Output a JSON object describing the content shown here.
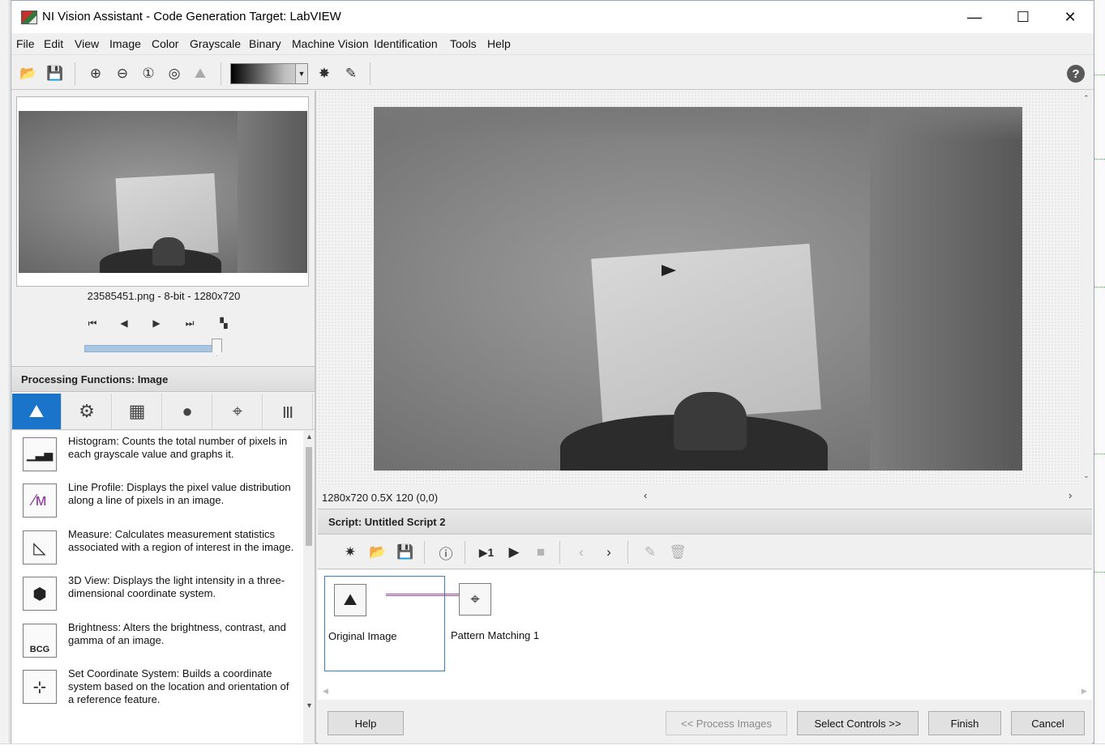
{
  "window": {
    "title": "NI Vision Assistant - Code Generation Target: LabVIEW",
    "minimize_glyph": "—",
    "maximize_glyph": "☐",
    "close_glyph": "✕"
  },
  "menu": [
    "File",
    "Edit",
    "View",
    "Image",
    "Color",
    "Grayscale",
    "Binary",
    "Machine Vision",
    "Identification",
    "Tools",
    "Help"
  ],
  "toolbar": {
    "icons": [
      "open-folder-icon",
      "save-icon",
      "zoom-in-icon",
      "zoom-out-icon",
      "zoom-1to1-icon",
      "zoom-fit-icon",
      "zoom-region-icon",
      "palette-dropdown",
      "brightness-icon",
      "annotate-pen-icon",
      "help-icon"
    ],
    "help_glyph": "?"
  },
  "browser": {
    "file_info": "23585451.png - 8-bit - 1280x720",
    "nav_glyphs": [
      "⏮",
      "◀",
      "▶",
      "⏭",
      "▚"
    ]
  },
  "processing": {
    "header": "Processing Functions: Image",
    "tabs": [
      "image-functions",
      "color-functions",
      "grayscale-functions",
      "binary-functions",
      "machine-vision-functions",
      "identification-functions"
    ],
    "tab_glyphs": [
      "⛰",
      "⚙",
      "▦",
      "●",
      "⌖",
      "|||"
    ],
    "items": [
      {
        "text": "Histogram:  Counts the total number of pixels in each grayscale value and graphs it.",
        "glyph": "▁▃▅",
        "icon": "histogram-icon"
      },
      {
        "text": "Line Profile:  Displays the pixel value distribution along a line of pixels in an image.",
        "glyph": "∕ᴍ",
        "icon": "line-profile-icon"
      },
      {
        "text": "Measure:  Calculates measurement statistics associated with a region of interest in the image.",
        "glyph": "◺",
        "icon": "measure-icon"
      },
      {
        "text": "3D View:  Displays the light intensity in a three-dimensional coordinate system.",
        "glyph": "⬢",
        "icon": "3d-view-icon"
      },
      {
        "text": "Brightness:  Alters the brightness, contrast, and gamma of an image.",
        "glyph": "BCG",
        "icon": "brightness-icon"
      },
      {
        "text": "Set Coordinate System:  Builds a coordinate system based on the location and orientation of a reference feature.",
        "glyph": "⊹",
        "icon": "coordinate-system-icon"
      }
    ]
  },
  "image_view": {
    "status": "1280x720 0.5X 120    (0,0)"
  },
  "script": {
    "header": "Script: Untitled Script 2",
    "steps": [
      {
        "label": "Original Image",
        "glyph": "⛰",
        "icon": "original-image-icon"
      },
      {
        "label": "Pattern Matching 1",
        "glyph": "⌖",
        "icon": "pattern-matching-icon"
      }
    ]
  },
  "buttons": {
    "help": "Help",
    "process_images": "<< Process Images",
    "select_controls": "Select Controls >>",
    "finish": "Finish",
    "cancel": "Cancel"
  }
}
